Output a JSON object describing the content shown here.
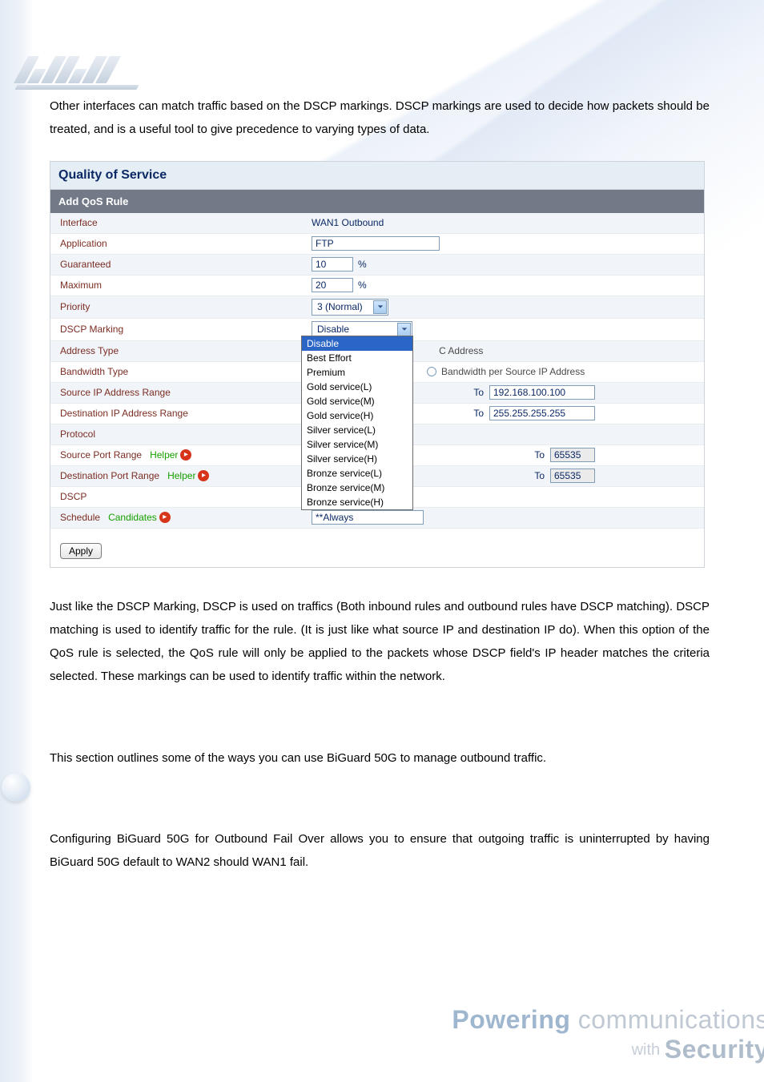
{
  "intro_paragraph": "Other interfaces can match traffic based on the DSCP markings. DSCP markings are used to decide how packets should be treated, and is a useful tool to give precedence to varying types of data.",
  "para_after_panel": "Just like the DSCP Marking, DSCP is used on traffics (Both inbound rules and outbound rules have DSCP matching). DSCP matching is used to identify traffic for the rule. (It is just like what source IP and destination IP do). When this option of the QoS rule is selected, the QoS rule will only be applied to the packets whose DSCP field's IP header matches the criteria selected. These markings can be used to identify traffic within the network.",
  "para_outline": "This section outlines some of the ways you can use BiGuard 50G to manage outbound traffic.",
  "para_failover": "Configuring BiGuard 50G for Outbound Fail Over allows you to ensure that outgoing traffic is uninterrupted by having BiGuard 50G default to WAN2 should WAN1 fail.",
  "panel": {
    "title": "Quality of Service",
    "subtitle": "Add QoS Rule",
    "labels": {
      "interface": "Interface",
      "application": "Application",
      "guaranteed": "Guaranteed",
      "maximum": "Maximum",
      "priority": "Priority",
      "dscp_marking": "DSCP Marking",
      "address_type": "Address Type",
      "bandwidth_type": "Bandwidth Type",
      "src_ip_range": "Source IP Address Range",
      "dst_ip_range": "Destination IP Address Range",
      "protocol": "Protocol",
      "src_port_range": "Source Port Range",
      "dst_port_range": "Destination Port Range",
      "dscp": "DSCP",
      "schedule": "Schedule",
      "helper": "Helper",
      "candidates": "Candidates"
    },
    "values": {
      "interface": "WAN1 Outbound",
      "application": "FTP",
      "guaranteed": "10",
      "maximum": "20",
      "pct": "%",
      "priority": "3 (Normal)",
      "dscp_marking_selected": "Disable",
      "address_right": "C Address",
      "bandwidth_right": "Bandwidth per Source IP Address",
      "to": "To",
      "src_ip_to": "192.168.100.100",
      "dst_ip_to": "255.255.255.255",
      "port_to": "65535",
      "schedule_value": "**Always"
    },
    "dropdown_items": [
      "Disable",
      "Best Effort",
      "Premium",
      "Gold service(L)",
      "Gold service(M)",
      "Gold service(H)",
      "Silver service(L)",
      "Silver service(M)",
      "Silver service(H)",
      "Bronze service(L)",
      "Bronze service(M)",
      "Bronze service(H)"
    ],
    "apply": "Apply"
  },
  "footer": {
    "powering": "Powering",
    "comm": " communications",
    "with": "with ",
    "security": "Security"
  }
}
